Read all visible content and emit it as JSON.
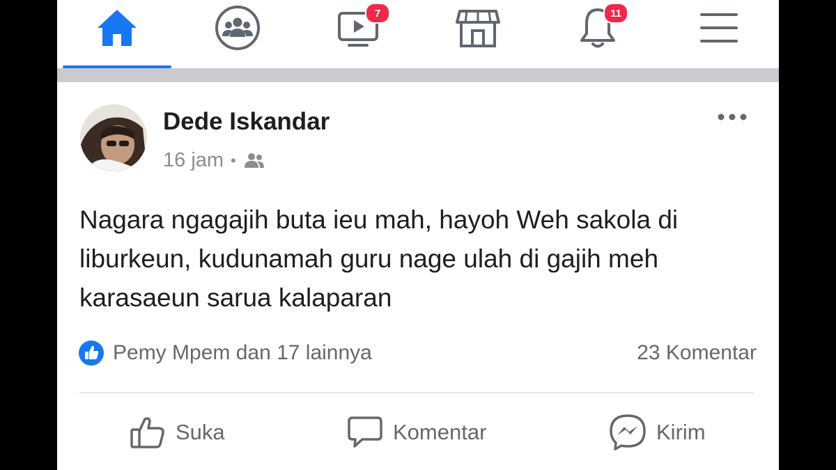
{
  "nav": {
    "items": [
      {
        "icon": "home-icon",
        "active": true
      },
      {
        "icon": "groups-icon"
      },
      {
        "icon": "watch-icon",
        "badge": "7"
      },
      {
        "icon": "marketplace-icon"
      },
      {
        "icon": "bell-icon",
        "badge": "11"
      },
      {
        "icon": "menu-icon"
      }
    ],
    "accent_color": "#1877f2",
    "badge_color": "#f02849"
  },
  "post": {
    "author": "Dede Iskandar",
    "time": "16 jam",
    "separator": "•",
    "audience_icon": "friends-icon",
    "text": "Nagara ngagajih buta ieu mah, hayoh Weh sakola di liburkeun, kudunamah guru nage ulah di gajih meh karasaeun sarua kalaparan",
    "reactions": "Pemy Mpem dan 17 lainnya",
    "comments": "23 Komentar"
  },
  "actions": {
    "like": "Suka",
    "comment": "Komentar",
    "send": "Kirim"
  }
}
